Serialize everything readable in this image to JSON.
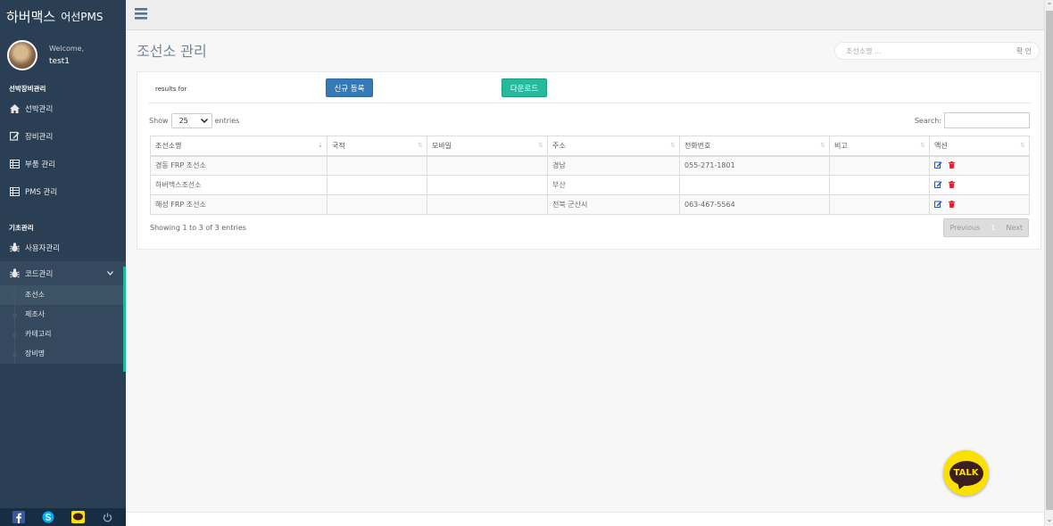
{
  "brand": {
    "name": "하버맥스",
    "product": "어선PMS"
  },
  "profile": {
    "welcome": "Welcome,",
    "user": "test1"
  },
  "sidebar": {
    "section1": "선박장비관리",
    "items1": [
      {
        "label": "선박관리",
        "icon": "home-icon"
      },
      {
        "label": "장비관리",
        "icon": "edit-icon"
      },
      {
        "label": "부품 관리",
        "icon": "table-icon"
      },
      {
        "label": "PMS 관리",
        "icon": "table-icon"
      }
    ],
    "section2": "기초관리",
    "items2": [
      {
        "label": "사용자관리",
        "icon": "bug-icon"
      },
      {
        "label": "코드관리",
        "icon": "bug-icon"
      }
    ],
    "submenu": [
      "조선소",
      "제조사",
      "카테고리",
      "장비명"
    ]
  },
  "page": {
    "title": "조선소 관리"
  },
  "top_search": {
    "placeholder": "조선소명 ...",
    "button": "확 인"
  },
  "toolbar": {
    "results_for": "results for",
    "new_label": "신규 등록",
    "download_label": "다운로드"
  },
  "table_ctrl": {
    "show": "Show",
    "entries_value": "25",
    "entries": "entries",
    "search": "Search:"
  },
  "table": {
    "columns": [
      "조선소명",
      "국적",
      "모바일",
      "주소",
      "전화번호",
      "비고",
      "액션"
    ],
    "rows": [
      [
        "경동 FRP 조선소",
        "",
        "",
        "경남",
        "055-271-1801",
        ""
      ],
      [
        "하버맥스조선소",
        "",
        "",
        "부산",
        "",
        ""
      ],
      [
        "해성 FRP 조선소",
        "",
        "",
        "전북 군산시",
        "063-467-5564",
        ""
      ]
    ]
  },
  "pagination": {
    "info": "Showing 1 to 3 of 3 entries",
    "previous": "Previous",
    "current": "1",
    "next": "Next"
  },
  "talk": {
    "label": "TALK"
  },
  "colors": {
    "sidebar": "#2a3f54",
    "primary": "#337ab7",
    "success": "#26b99a",
    "accent": "#1abb9c",
    "kakao": "#fae100"
  }
}
